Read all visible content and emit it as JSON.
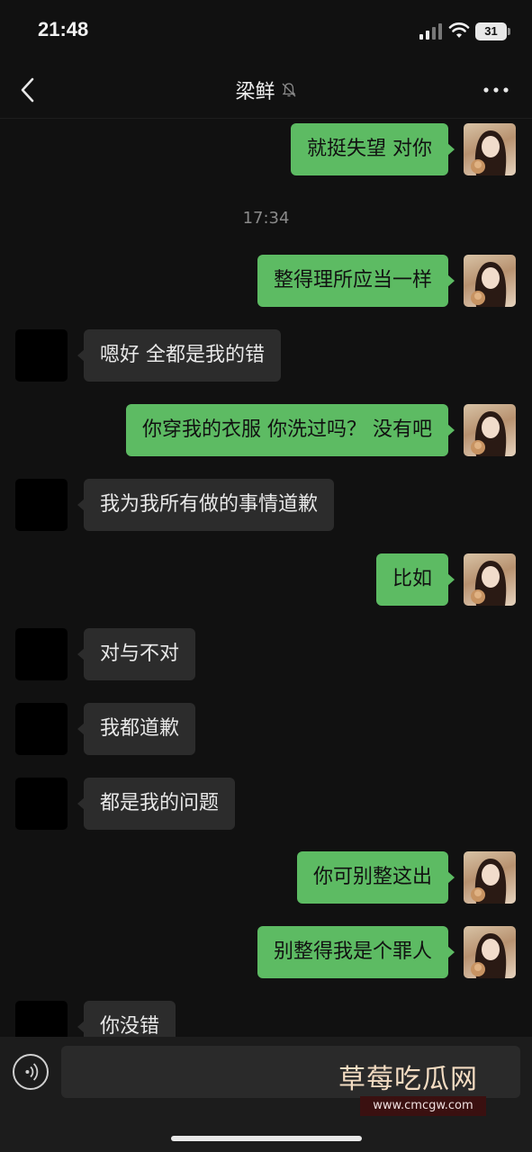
{
  "status_bar": {
    "time": "21:48",
    "battery": "31"
  },
  "header": {
    "title": "梁鲜"
  },
  "timestamp": "17:34",
  "messages": [
    {
      "side": "out",
      "text": "就挺失望 对你"
    },
    {
      "side": "out",
      "text": "整得理所应当一样"
    },
    {
      "side": "in",
      "text": "嗯好 全都是我的错"
    },
    {
      "side": "out",
      "text": "你穿我的衣服 你洗过吗？ 没有吧"
    },
    {
      "side": "in",
      "text": "我为我所有做的事情道歉"
    },
    {
      "side": "out",
      "text": "比如"
    },
    {
      "side": "in",
      "text": "对与不对"
    },
    {
      "side": "in",
      "text": "我都道歉"
    },
    {
      "side": "in",
      "text": "都是我的问题"
    },
    {
      "side": "out",
      "text": "你可别整这出"
    },
    {
      "side": "out",
      "text": "别整得我是个罪人"
    },
    {
      "side": "in",
      "text": "你没错"
    }
  ],
  "watermark": {
    "text": "草莓吃瓜网",
    "url": "www.cmcgw.com"
  },
  "icons": {
    "back": "chevron-left-icon",
    "mute": "bell-off-icon",
    "more": "more-dots-icon",
    "voice": "voice-icon",
    "signal": "signal-icon",
    "wifi": "wifi-icon",
    "battery": "battery-icon"
  }
}
